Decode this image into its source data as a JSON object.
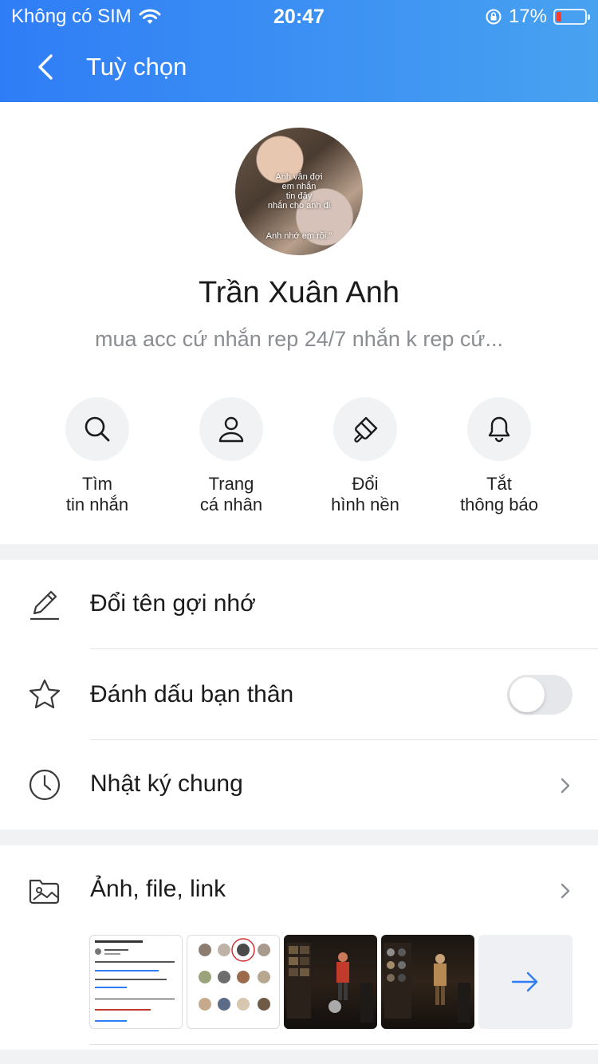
{
  "status_bar": {
    "carrier": "Không có SIM",
    "time": "20:47",
    "battery_percent": "17%",
    "battery_level": 0.17,
    "icons": [
      "wifi-icon",
      "orientation-lock-icon",
      "battery-icon"
    ]
  },
  "nav": {
    "back_icon": "chevron-left-icon",
    "title": "Tuỳ chọn"
  },
  "profile": {
    "avatar_caption": [
      "Anh vẫn đợi",
      "em nhắn",
      "tin đây",
      "nhắn cho anh đi",
      "Anh nhớ em rồi.\""
    ],
    "name": "Trần Xuân Anh",
    "bio": "mua acc cứ nhắn rep 24/7 nhắn k rep cứ..."
  },
  "actions": [
    {
      "icon": "search-icon",
      "line1": "Tìm",
      "line2": "tin nhắn"
    },
    {
      "icon": "person-icon",
      "line1": "Trang",
      "line2": "cá nhân"
    },
    {
      "icon": "paint-brush-icon",
      "line1": "Đổi",
      "line2": "hình nền"
    },
    {
      "icon": "bell-icon",
      "line1": "Tắt",
      "line2": "thông báo"
    }
  ],
  "settings": {
    "rename": {
      "icon": "pencil-icon",
      "label": "Đổi tên gợi nhớ"
    },
    "best_friend": {
      "icon": "star-icon",
      "label": "Đánh dấu bạn thân",
      "toggle_on": false
    },
    "diary": {
      "icon": "clock-icon",
      "label": "Nhật ký chung"
    }
  },
  "media": {
    "icon": "photo-folder-icon",
    "label": "Ảnh, file, link",
    "more_icon": "arrow-right-icon"
  },
  "colors": {
    "header_start": "#2f7df6",
    "header_end": "#48a2f0",
    "accent": "#2f7df6",
    "gap": "#f1f2f4"
  }
}
